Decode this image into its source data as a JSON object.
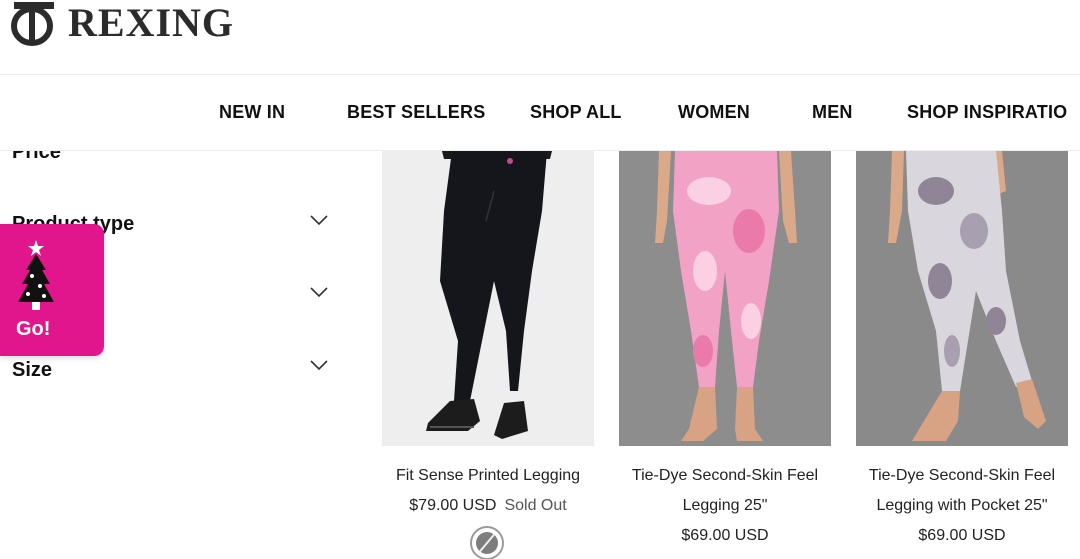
{
  "brand": {
    "name": "REXING"
  },
  "nav": {
    "items": [
      "NEW IN",
      "BEST SELLERS",
      "SHOP ALL",
      "WOMEN",
      "MEN",
      "SHOP INSPIRATIO"
    ]
  },
  "filters": {
    "items": [
      {
        "label": "Price"
      },
      {
        "label": "Product type"
      },
      {
        "label": ""
      },
      {
        "label": "Size"
      }
    ]
  },
  "promo": {
    "label": "Go!",
    "icon": "christmas-tree-icon",
    "color": "#e2168c"
  },
  "products": [
    {
      "name": "Fit Sense Printed Legging",
      "price": "$79.00 USD",
      "status": "Sold Out"
    },
    {
      "name_line1": "Tie-Dye Second-Skin Feel",
      "name_line2": "Legging 25\"",
      "price": "$69.00 USD"
    },
    {
      "name_line1": "Tie-Dye Second-Skin Feel",
      "name_line2": "Legging with Pocket 25\"",
      "price": "$69.00 USD"
    }
  ]
}
